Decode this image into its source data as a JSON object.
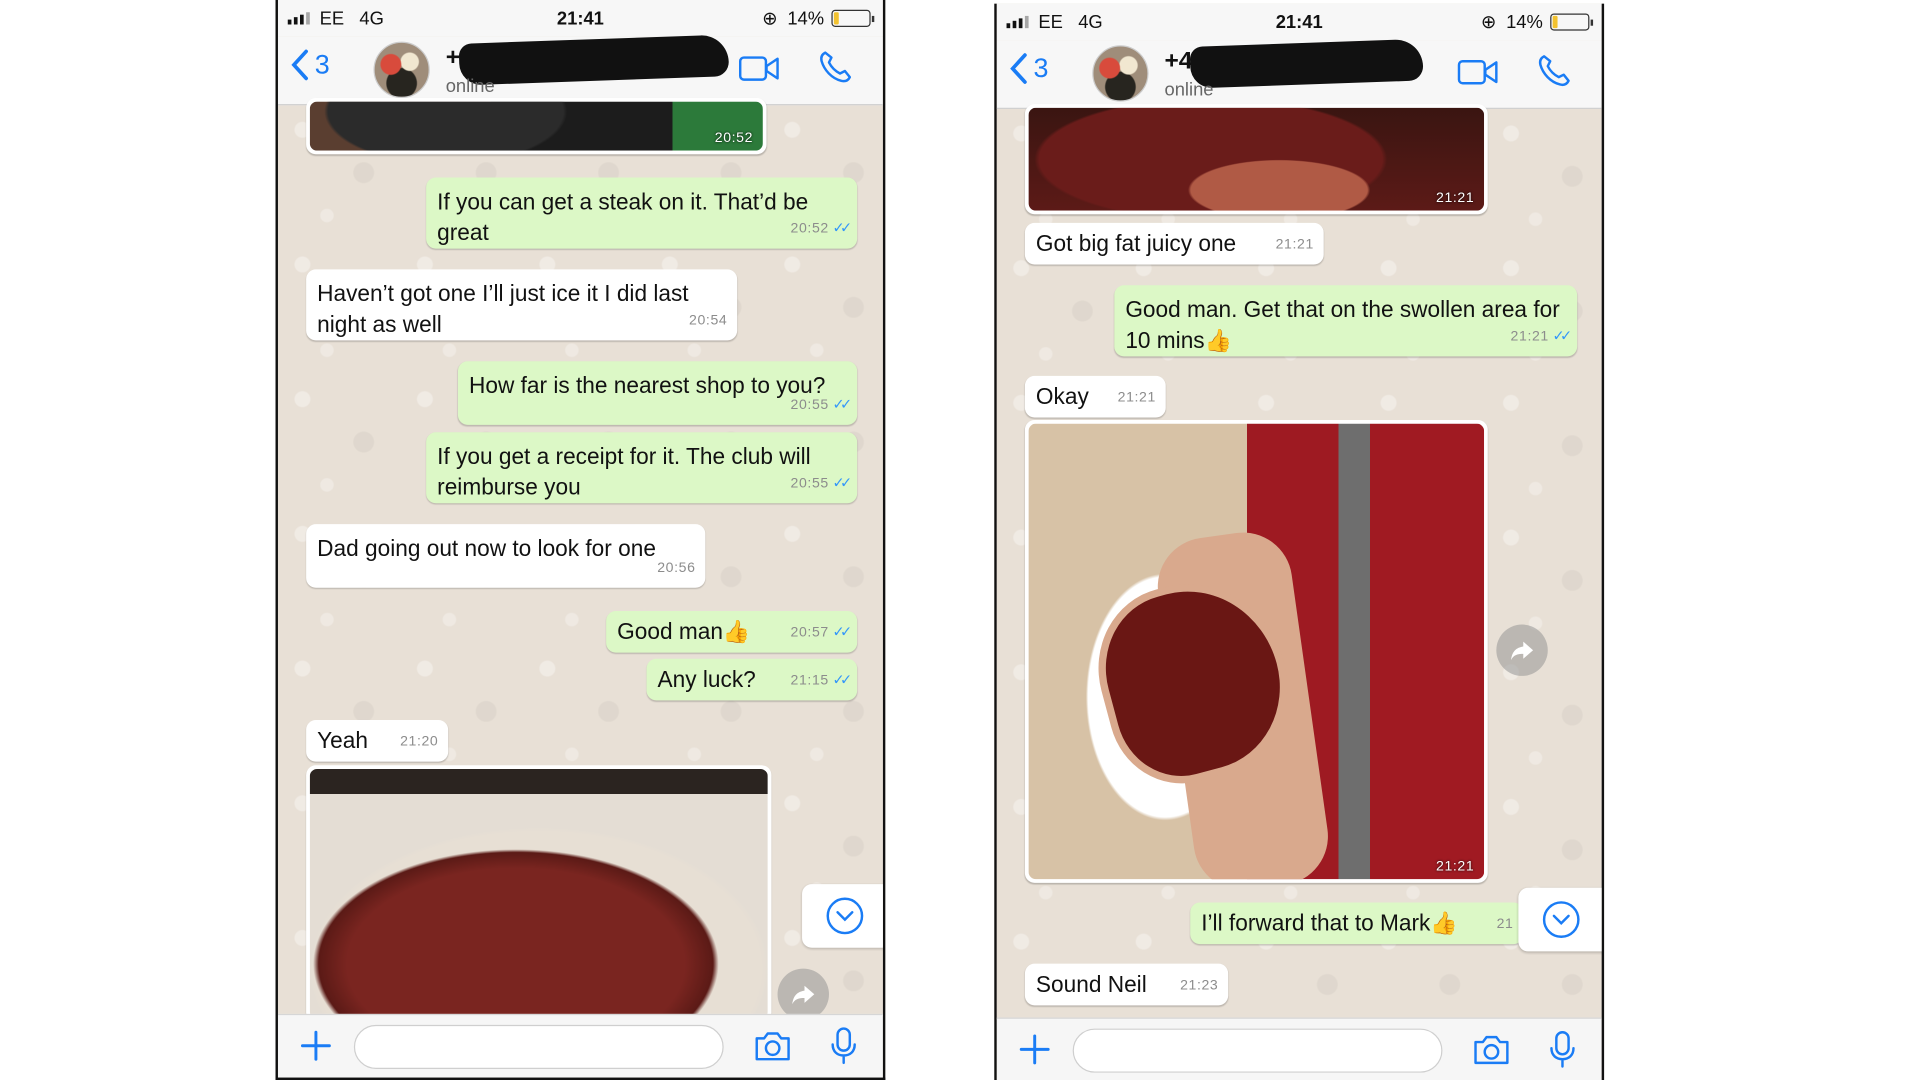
{
  "left_phone": {
    "status": {
      "carrier": "EE",
      "network": "4G",
      "time": "21:41",
      "battery": "14%",
      "battery_level": 0.14
    },
    "header": {
      "back_count": "3",
      "contact_name": "+44",
      "status": "online"
    },
    "messages": [
      {
        "type": "photo",
        "dir": "in",
        "time": "20:52",
        "image": "leg-photo"
      },
      {
        "type": "text",
        "dir": "out",
        "text": "If you can get a steak on it. That’d be great",
        "time": "20:52",
        "read": true
      },
      {
        "type": "text",
        "dir": "in",
        "text": "Haven’t got one I’ll just ice it I did last night as well",
        "time": "20:54"
      },
      {
        "type": "text",
        "dir": "out",
        "text": "How far is the nearest shop to you?",
        "time": "20:55",
        "read": true
      },
      {
        "type": "text",
        "dir": "out",
        "text": "If you get a receipt for it. The club will reimburse you",
        "time": "20:55",
        "read": true
      },
      {
        "type": "text",
        "dir": "in",
        "text": "Dad going out now to look for one",
        "time": "20:56"
      },
      {
        "type": "text",
        "dir": "out",
        "text": "Good man",
        "emoji": "👍",
        "time": "20:57",
        "read": true
      },
      {
        "type": "text",
        "dir": "out",
        "text": "Any luck?",
        "time": "21:15",
        "read": true
      },
      {
        "type": "text",
        "dir": "in",
        "text": "Yeah",
        "time": "21:20"
      },
      {
        "type": "photo",
        "dir": "in",
        "time": "",
        "image": "steak-photo"
      }
    ]
  },
  "right_phone": {
    "status": {
      "carrier": "EE",
      "network": "4G",
      "time": "21:41",
      "battery": "14%",
      "battery_level": 0.14
    },
    "header": {
      "back_count": "3",
      "contact_name": "+44",
      "status": "online"
    },
    "messages": [
      {
        "type": "photo",
        "dir": "in",
        "time": "21:21",
        "image": "steak-photo"
      },
      {
        "type": "text",
        "dir": "in",
        "text": "Got big fat juicy one",
        "time": "21:21"
      },
      {
        "type": "text",
        "dir": "out",
        "text": "Good man. Get that on the swollen area for 10 mins",
        "emoji": "👍",
        "time": "21:21",
        "read": true
      },
      {
        "type": "text",
        "dir": "in",
        "text": "Okay",
        "time": "21:21"
      },
      {
        "type": "photo",
        "dir": "in",
        "time": "21:21",
        "image": "foot-with-steak-photo"
      },
      {
        "type": "text",
        "dir": "out",
        "text": "I’ll forward that to Mark",
        "emoji": "👍",
        "time": "21",
        "read": true
      },
      {
        "type": "text",
        "dir": "in",
        "text": "Sound Neil",
        "time": "21:23"
      }
    ]
  },
  "icons": {
    "back": "chevron-left-icon",
    "video": "video-camera-icon",
    "call": "phone-icon",
    "forward": "forward-arrow-icon",
    "scroll": "chevron-down-circle-icon",
    "attach": "plus-icon",
    "camera": "camera-icon",
    "mic": "microphone-icon"
  },
  "colors": {
    "accent": "#1a7cf5",
    "outgoing_bubble": "#dcf8c6",
    "incoming_bubble": "#ffffff",
    "read_ticks": "#3497f9",
    "wallpaper": "#e8e0d6"
  }
}
